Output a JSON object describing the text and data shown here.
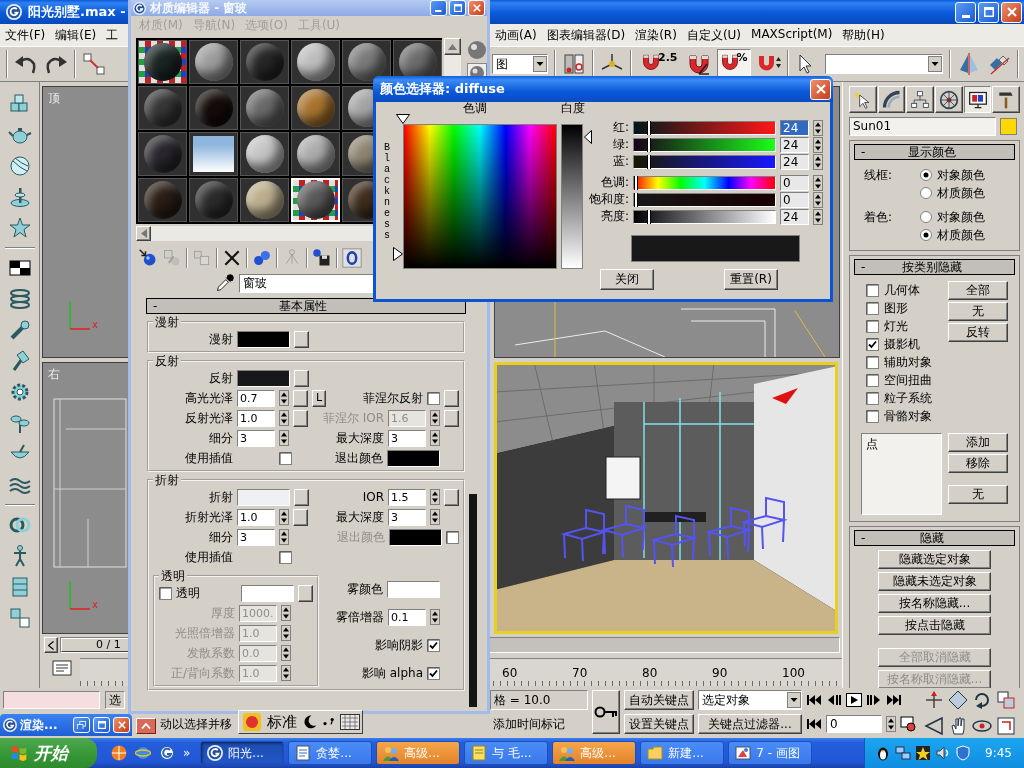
{
  "app_window": {
    "title": "阳光别墅.max -"
  },
  "menu_bar": {
    "left": [
      "文件(F)",
      "编辑(E)",
      "工"
    ],
    "right": [
      "动画(A)",
      "图表编辑器(D)",
      "渲染(R)",
      "自定义(U)",
      "MAXScript(M)",
      "帮助(H)"
    ]
  },
  "toolbar": {
    "view_dropdown": "图",
    "snap_buttons": [
      {
        "label": "2.5",
        "on": false
      },
      {
        "label": "%",
        "on": true
      }
    ]
  },
  "material_editor": {
    "title": "材质编辑器 - 窗玻",
    "menu": [
      {
        "label": "材质(M)",
        "disabled": true
      },
      {
        "label": "导航(N)",
        "disabled": true
      },
      {
        "label": "选项(O)",
        "disabled": true
      },
      {
        "label": "工具(U)",
        "disabled": true
      }
    ],
    "sample_rows": [
      [
        {
          "kind": "checker",
          "color": "#1a2624",
          "selected": false
        },
        {
          "kind": "sphere",
          "color": "#9c9c9c",
          "selected": false
        },
        {
          "kind": "sphere",
          "color": "#262626",
          "selected": false
        },
        {
          "kind": "sphere",
          "color": "#bdbdbd",
          "selected": false
        },
        {
          "kind": "sphere",
          "color": "#7a7a7a",
          "selected": false
        },
        {
          "kind": "sphere",
          "color": "#6c6c6c",
          "selected": false
        }
      ],
      [
        {
          "kind": "sphere",
          "color": "#363636",
          "selected": false
        },
        {
          "kind": "sphere",
          "color": "#140c0a",
          "selected": false
        },
        {
          "kind": "sphere",
          "color": "#6a6a6a",
          "selected": false
        },
        {
          "kind": "sphere",
          "color": "#a8742e",
          "selected": false
        },
        {
          "kind": "sphere",
          "color": "#a4a4a4",
          "selected": false
        }
      ],
      [
        {
          "kind": "sphere",
          "color": "#2a282e",
          "selected": false
        },
        {
          "kind": "flat",
          "color": "#8fb6dc",
          "selected": false
        },
        {
          "kind": "sphere",
          "color": "#c4c4c4",
          "selected": false
        },
        {
          "kind": "sphere",
          "color": "#acacac",
          "selected": false
        },
        {
          "kind": "sphere",
          "color": "#8e8470",
          "selected": false
        }
      ],
      [
        {
          "kind": "sphere",
          "color": "#2a1e16",
          "selected": false
        },
        {
          "kind": "sphere",
          "color": "#2c2c2c",
          "selected": false
        },
        {
          "kind": "sphere",
          "color": "#bcae8c",
          "selected": false
        },
        {
          "kind": "checker",
          "color": "#5a5a5a",
          "selected": true
        },
        {
          "kind": "sphere",
          "color": "#3e2c1c",
          "selected": false
        }
      ]
    ],
    "toolbar": [
      {
        "disabled": false
      },
      {
        "disabled": true
      },
      {
        "disabled": true
      },
      {
        "disabled": false
      },
      {
        "disabled": false
      },
      {
        "disabled": true
      },
      {
        "disabled": false
      },
      {
        "disabled": false
      }
    ],
    "material_name": "窗玻",
    "rollout": {
      "toggle": "-",
      "title": "基本属性"
    },
    "groups": [
      {
        "title": "漫射",
        "rows": [
          {
            "left": {
              "kind": "swatch",
              "label": "漫射",
              "color": "#000000",
              "map": true,
              "disabled": false
            }
          }
        ]
      },
      {
        "title": "反射",
        "rows": [
          {
            "left": {
              "kind": "swatch",
              "label": "反射",
              "color": "#181818",
              "map": true,
              "disabled": false
            }
          },
          {
            "left": {
              "kind": "spinner",
              "label": "高光光泽",
              "value": "0.7",
              "map": true,
              "lock": "L",
              "disabled": false
            },
            "right": {
              "kind": "checkbox",
              "label": "菲涅尔反射",
              "checked": false,
              "map": true,
              "disabled": false
            }
          },
          {
            "left": {
              "kind": "spinner",
              "label": "反射光泽",
              "value": "1.0",
              "map": true,
              "disabled": false
            },
            "right": {
              "kind": "spinner",
              "label": "菲涅尔 IOR",
              "value": "1.6",
              "map": true,
              "disabled": true
            }
          },
          {
            "left": {
              "kind": "spinner",
              "label": "细分",
              "value": "3",
              "map": false,
              "disabled": false
            },
            "right": {
              "kind": "spinner",
              "label": "最大深度",
              "value": "3",
              "map": false,
              "disabled": false
            }
          },
          {
            "left": {
              "kind": "checkbox",
              "label": "使用插值",
              "checked": false,
              "map": false,
              "disabled": false
            },
            "right": {
              "kind": "swatch",
              "label": "退出颜色",
              "color": "#000000",
              "map": false,
              "disabled": false
            }
          }
        ]
      },
      {
        "title": "折射",
        "rows": [
          {
            "left": {
              "kind": "swatch",
              "label": "折射",
              "color": "#eef0f3",
              "map": true,
              "disabled": false
            },
            "right": {
              "kind": "spinner",
              "label": "IOR",
              "value": "1.5",
              "map": true,
              "disabled": false
            }
          },
          {
            "left": {
              "kind": "spinner",
              "label": "折射光泽",
              "value": "1.0",
              "map": true,
              "disabled": false
            },
            "right": {
              "kind": "spinner",
              "label": "最大深度",
              "value": "3",
              "map": false,
              "disabled": false
            }
          },
          {
            "left": {
              "kind": "spinner",
              "label": "细分",
              "value": "3",
              "map": false,
              "disabled": false
            },
            "right": {
              "kind": "swatch",
              "label": "退出颜色",
              "color": "#000000",
              "checked": false,
              "map": false,
              "disabled": true
            }
          },
          {
            "left": {
              "kind": "checkbox",
              "label": "使用插值",
              "checked": false,
              "map": false,
              "disabled": false
            }
          }
        ],
        "transparency": {
          "title": "透明",
          "items": [
            {
              "kind": "checkitem",
              "label": "透明",
              "checked": false,
              "color": "#ffffff",
              "map": true,
              "disabled": false
            },
            {
              "kind": "spinner",
              "label": "厚度",
              "value": "1000.",
              "map": false,
              "disabled": true
            },
            {
              "kind": "spinner",
              "label": "光照倍增器",
              "value": "1.0",
              "map": false,
              "disabled": true
            },
            {
              "kind": "spinner",
              "label": "发散系数",
              "value": "0.0",
              "map": false,
              "disabled": true
            },
            {
              "kind": "spinner",
              "label": "正/背向系数",
              "value": "1.0",
              "map": false,
              "disabled": true
            }
          ]
        },
        "fog": [
          {
            "kind": "swatch",
            "label": "雾颜色",
            "color": "#ffffff",
            "map": false,
            "disabled": false
          },
          {
            "kind": "spinner",
            "label": "雾倍增器",
            "value": "0.1",
            "map": false,
            "disabled": false
          },
          {
            "kind": "checkbox",
            "label": "影响阴影",
            "checked": true,
            "map": false,
            "disabled": false
          },
          {
            "kind": "checkbox",
            "label": "影响 alpha",
            "checked": true,
            "map": false,
            "disabled": false
          }
        ]
      }
    ]
  },
  "color_picker": {
    "title": "颜色选择器: diffuse",
    "hue_label": "色调",
    "whiteness_label": "白度",
    "blackness_label": "Blackness",
    "channels": [
      {
        "kind": "red",
        "label": "红:",
        "value": "24",
        "level": 0.094,
        "focused": true
      },
      {
        "kind": "green",
        "label": "绿:",
        "value": "24",
        "level": 0.094,
        "focused": false
      },
      {
        "kind": "blue",
        "label": "蓝:",
        "value": "24",
        "level": 0.094,
        "focused": false
      },
      {
        "kind": "hue",
        "label": "色调:",
        "value": "0",
        "level": 0,
        "focused": false
      },
      {
        "kind": "saturation",
        "label": "饱和度:",
        "value": "0",
        "level": 0,
        "focused": false
      },
      {
        "kind": "value",
        "label": "亮度:",
        "value": "24",
        "level": 0.094,
        "focused": false
      }
    ],
    "preview": {
      "color": "#181818"
    },
    "buttons": [
      "关闭",
      "重置(R)"
    ]
  },
  "viewports": {
    "top_left": {
      "label": "顶",
      "axis": "x"
    },
    "bottom_left": {
      "label": "右",
      "axis": "x"
    }
  },
  "command_panel": {
    "tabs": [
      {
        "selected": false
      },
      {
        "selected": false
      },
      {
        "selected": false
      },
      {
        "selected": false
      },
      {
        "selected": true
      },
      {
        "selected": false
      }
    ],
    "object": {
      "name": "Sun01",
      "color": "#ffd800"
    },
    "display_color": {
      "toggle": "-",
      "title": "显示颜色",
      "groups": [
        {
          "label": "线框:",
          "options": [
            {
              "label": "对象颜色",
              "selected": true
            },
            {
              "label": "材质颜色",
              "selected": false
            }
          ]
        },
        {
          "label": "着色:",
          "options": [
            {
              "label": "对象颜色",
              "selected": false
            },
            {
              "label": "材质颜色",
              "selected": true
            }
          ]
        }
      ]
    },
    "hide_by_category": {
      "toggle": "-",
      "title": "按类别隐藏",
      "categories": [
        {
          "label": "几何体",
          "checked": false
        },
        {
          "label": "图形",
          "checked": false
        },
        {
          "label": "灯光",
          "checked": false
        },
        {
          "label": "摄影机",
          "checked": true
        },
        {
          "label": "辅助对象",
          "checked": false
        },
        {
          "label": "空间扭曲",
          "checked": false
        },
        {
          "label": "粒子系统",
          "checked": false
        },
        {
          "label": "骨骼对象",
          "checked": false
        }
      ],
      "buttons": [
        "全部",
        "无",
        "反转"
      ],
      "list": [
        {
          "label": "点",
          "selected": false
        }
      ],
      "list_buttons": [
        "添加",
        "移除",
        "无"
      ]
    },
    "hide": {
      "toggle": "-",
      "title": "隐藏",
      "buttons": [
        {
          "label": "隐藏选定对象",
          "disabled": false
        },
        {
          "label": "隐藏未选定对象",
          "disabled": false
        },
        {
          "label": "按名称隐藏...",
          "disabled": false
        },
        {
          "label": "按点击隐藏",
          "disabled": false
        },
        {
          "label": "全部取消隐藏",
          "disabled": true
        },
        {
          "label": "按名称取消隐藏...",
          "disabled": true
        }
      ]
    }
  },
  "time_slider": {
    "position": "0 / 1",
    "level": 0
  },
  "track_bar": {
    "ticks": [
      "60",
      "70",
      "80",
      "90",
      "100"
    ]
  },
  "status_bar": {
    "selection": "选",
    "prompt": "动以选择并移",
    "grid": "格 = 10.0",
    "add_time_tag": "添加时间标记"
  },
  "animation_controls": {
    "auto_key": "自动关键点",
    "set_key": "设置关键点",
    "key_set": "选定对象",
    "key_filters": "关键点过滤器...",
    "frame": "0"
  },
  "minimized_window": {
    "title": "渲染..."
  },
  "ime_bar": {
    "mode": "标准"
  },
  "taskbar": {
    "start": "开始",
    "more": "»",
    "tasks": [
      {
        "label": "阳光...",
        "selected": true,
        "flashing": false
      },
      {
        "label": "贪婪...",
        "selected": false,
        "flashing": false
      },
      {
        "label": "高级...",
        "selected": false,
        "flashing": true
      },
      {
        "label": "与 毛...",
        "selected": false,
        "flashing": false
      },
      {
        "label": "高级...",
        "selected": false,
        "flashing": true
      },
      {
        "label": "新建...",
        "selected": false,
        "flashing": false
      },
      {
        "label": "7 - 画图",
        "selected": false,
        "flashing": false
      }
    ],
    "clock": "9:45"
  }
}
